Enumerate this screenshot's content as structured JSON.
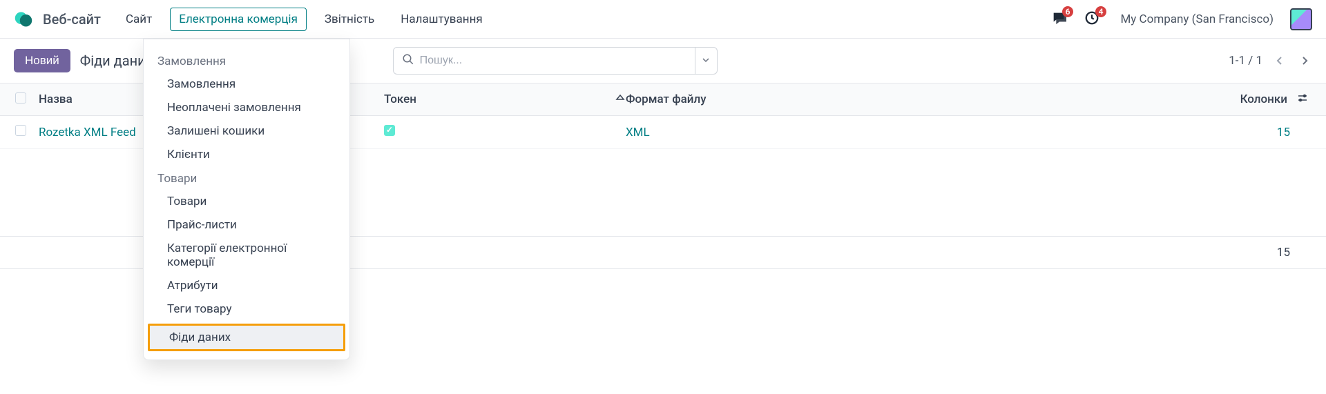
{
  "topnav": {
    "app_title": "Веб-сайт",
    "items": [
      "Сайт",
      "Електронна комерція",
      "Звітність",
      "Налаштування"
    ],
    "active_index": 1,
    "badge_messages": "6",
    "badge_activities": "4",
    "company": "My Company (San Francisco)"
  },
  "controlbar": {
    "new_button": "Новий",
    "breadcrumb": "Фіди даних",
    "search_placeholder": "Пошук...",
    "pager": "1-1 / 1"
  },
  "table": {
    "headers": {
      "name": "Назва",
      "token": "Токен",
      "format": "Формат файлу",
      "columns": "Колонки"
    },
    "rows": [
      {
        "name": "Rozetka XML Feed",
        "token_checked": true,
        "format": "XML",
        "columns": "15"
      }
    ],
    "footer_total": "15"
  },
  "dropdown": {
    "sections": [
      {
        "title": "Замовлення",
        "items": [
          "Замовлення",
          "Неоплачені замовлення",
          "Залишені кошики",
          "Клієнти"
        ]
      },
      {
        "title": "Товари",
        "items": [
          "Товари",
          "Прайс-листи",
          "Категорії електронної комерції",
          "Атрибути",
          "Теги товару",
          "Фіди даних"
        ]
      }
    ],
    "highlighted": "Фіди даних"
  }
}
